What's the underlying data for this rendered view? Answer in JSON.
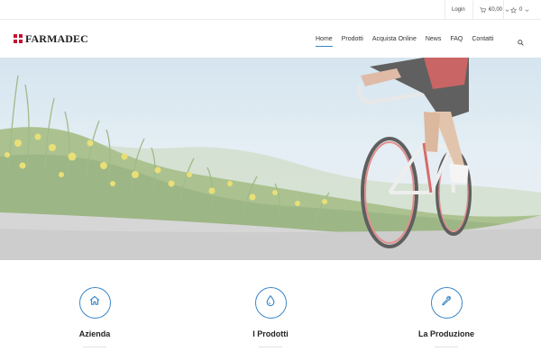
{
  "topbar": {
    "login_label": "Login",
    "cart_total": "€0,00",
    "wishlist_count": "0",
    "icons": [
      "cart-icon",
      "chevron-down-icon",
      "star-icon"
    ]
  },
  "header": {
    "brand": "FARMADEC",
    "brand_color": "#c8102e",
    "nav": [
      {
        "label": "Home",
        "active": true
      },
      {
        "label": "Prodotti",
        "active": false
      },
      {
        "label": "Acquista Online",
        "active": false
      },
      {
        "label": "News",
        "active": false
      },
      {
        "label": "FAQ",
        "active": false
      },
      {
        "label": "Contatti",
        "active": false
      }
    ],
    "accent_color": "#3a86c8"
  },
  "features": [
    {
      "title": "Azienda",
      "icon": "home-icon"
    },
    {
      "title": "I Prodotti",
      "icon": "drop-icon"
    },
    {
      "title": "La Produzione",
      "icon": "pipette-icon"
    }
  ]
}
